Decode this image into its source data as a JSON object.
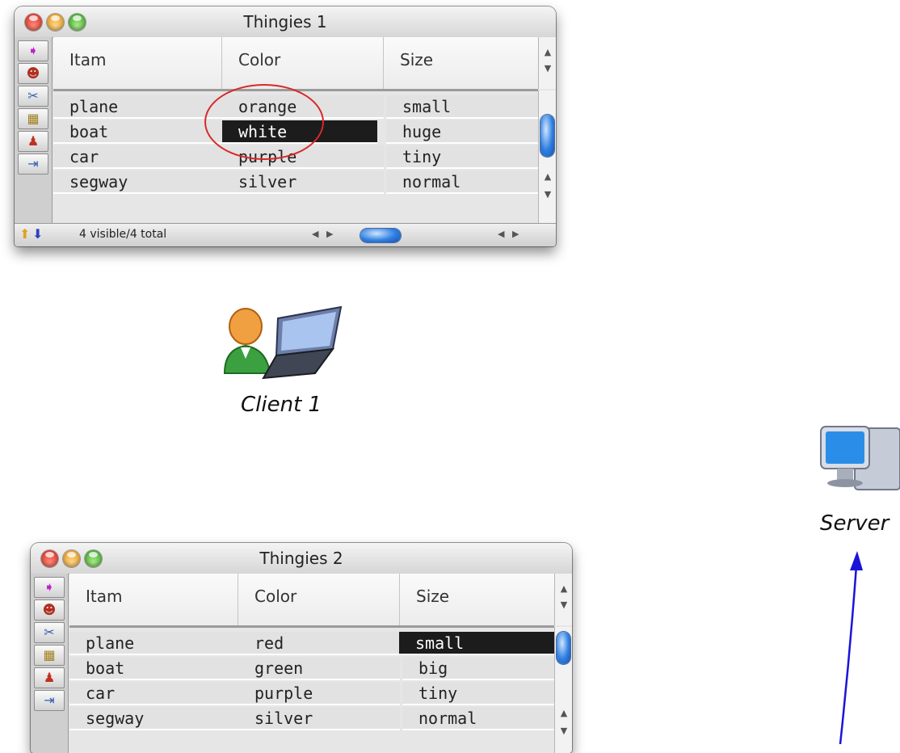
{
  "windows": [
    {
      "title": "Thingies 1",
      "columns": [
        "Itam",
        "Color",
        "Size"
      ],
      "rows": [
        {
          "item": "plane",
          "color": "orange",
          "size": "small"
        },
        {
          "item": "boat",
          "color": "white",
          "size": "huge"
        },
        {
          "item": "car",
          "color": "purple",
          "size": "tiny"
        },
        {
          "item": "segway",
          "color": "silver",
          "size": "normal"
        }
      ],
      "selected_cell": "color:1",
      "status": "4 visible/4 total"
    },
    {
      "title": "Thingies 2",
      "columns": [
        "Itam",
        "Color",
        "Size"
      ],
      "rows": [
        {
          "item": "plane",
          "color": "red",
          "size": "small"
        },
        {
          "item": "boat",
          "color": "green",
          "size": "big"
        },
        {
          "item": "car",
          "color": "purple",
          "size": "tiny"
        },
        {
          "item": "segway",
          "color": "silver",
          "size": "normal"
        }
      ],
      "selected_cell": "size:0"
    }
  ],
  "labels": {
    "client": "Client 1",
    "server": "Server"
  },
  "icons": {
    "tools": [
      "pointer-icon",
      "people-icon",
      "scissors-icon",
      "form-icon",
      "stamp-icon",
      "arrow-right-icon"
    ],
    "client": "user-laptop-icon",
    "server": "server-computer-icon"
  },
  "colors": {
    "annotation_circle": "#d82828",
    "arrow": "#1a14d8",
    "selection": "#1c1c1c"
  }
}
